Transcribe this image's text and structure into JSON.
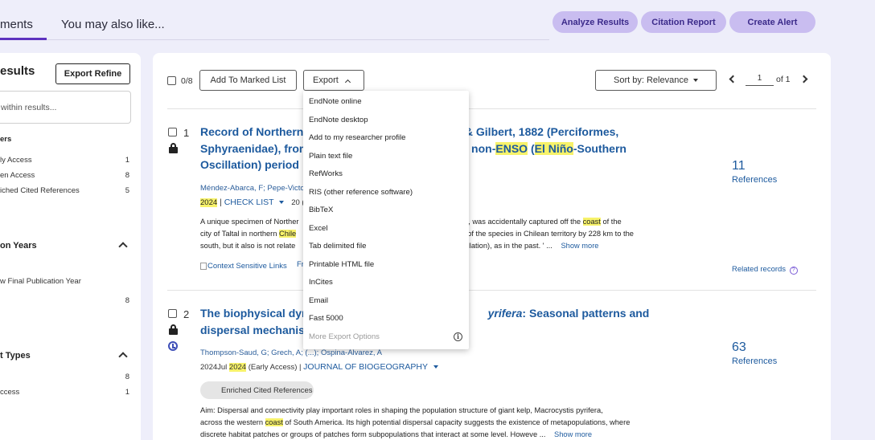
{
  "top_tabs": [
    "ments",
    "You may also like..."
  ],
  "top_buttons": {
    "analyze": "Analyze Results",
    "citation": "Citation Report",
    "alert": "Create Alert"
  },
  "left_panel": {
    "results_title": "esults",
    "export_refine": "Export Refine",
    "search_placeholder": "within results...",
    "filters_head": "ers",
    "filters": [
      {
        "label": "ly Access",
        "count": "1"
      },
      {
        "label": "en Access",
        "count": "8"
      },
      {
        "label": "iched Cited References",
        "count": "5"
      }
    ],
    "pub_years_head": "on Years",
    "pub_years_item": "w Final Publication Year",
    "pub_years_count": "8",
    "doc_types_head": "t Types",
    "doc_types": [
      {
        "label": "",
        "count": "8"
      },
      {
        "label": "ccess",
        "count": "1"
      }
    ]
  },
  "toolbar": {
    "select_count": "0/8",
    "add_marked": "Add To Marked List",
    "export": "Export",
    "sort": "Sort by: Relevance",
    "page_value": "1",
    "page_of": "of 1"
  },
  "export_menu": {
    "items": [
      "EndNote online",
      "EndNote desktop",
      "Add to my researcher profile",
      "Plain text file",
      "RefWorks",
      "RIS (other reference software)",
      "BibTeX",
      "Excel",
      "Tab delimited file",
      "Printable HTML file",
      "InCites",
      "Email",
      "Fast 5000"
    ],
    "more": "More Export Options",
    "info": "i"
  },
  "results": [
    {
      "num": "1",
      "title_l1a": "Record of Northern I",
      "title_l1b": "dan & Gilbert, 1882 (Perciformes,",
      "title_l2a": "Sphyraenidae), from",
      "title_l2b": "ng a non-",
      "title_hl1": "ENSO",
      "title_l2c": " (",
      "title_hl2": "El Niño",
      "title_l2d": "-Southern",
      "title_l3": "Oscillation) period",
      "authors": "Méndez-Abarca, F; Pepe-Victo",
      "year": "2024",
      "journal": "CHECK LIST",
      "vol": "20 (3",
      "abs_l1a": "A unique specimen of Norther",
      "abs_l1b": "1882, was accidentally captured off the ",
      "abs_l1hl": "coast",
      "abs_l1c": " of the",
      "abs_l2a": "city of Taltal in northern ",
      "abs_l2hl": "Chile",
      "abs_l2b": "of the species in Chilean territory by 228 km to the",
      "abs_l3a": "south, but it also is not relate",
      "abs_l3b": "scillation), as in the past. ' ...",
      "show_more": "Show more",
      "context_links": "Context Sensitive Links",
      "full_text": "Fr",
      "ref_count": "11",
      "ref_label": "References",
      "related": "Related records",
      "help": "?"
    },
    {
      "num": "2",
      "title_l1a": "The biophysical dyn",
      "title_l1b_it": "yrifera",
      "title_l1c": ": Seasonal patterns and",
      "title_l2": "dispersal mechanism",
      "authors": "Thompson-Saud, G; Grech, A; (...); Ospina-Alvarez, A",
      "date_prefix": "2024Jul ",
      "year": "2024",
      "access": " (Early Access) | ",
      "journal": "JOURNAL OF BIOGEOGRAPHY",
      "badge": "Enriched Cited References",
      "abs_l1": "Aim: Dispersal and connectivity play important roles in shaping the population structure of giant kelp, Macrocystis pyrifera,",
      "abs_l2a": "across the western ",
      "abs_l2hl": "coast",
      "abs_l2b": " of South America. Its high potential dispersal capacity suggests the existence of metapopulations, where",
      "abs_l3": "discrete habitat patches or groups of patches form subpopulations that interact at some level. Howeve ...",
      "show_more": "Show more",
      "ref_count": "63",
      "ref_label": "References"
    }
  ]
}
